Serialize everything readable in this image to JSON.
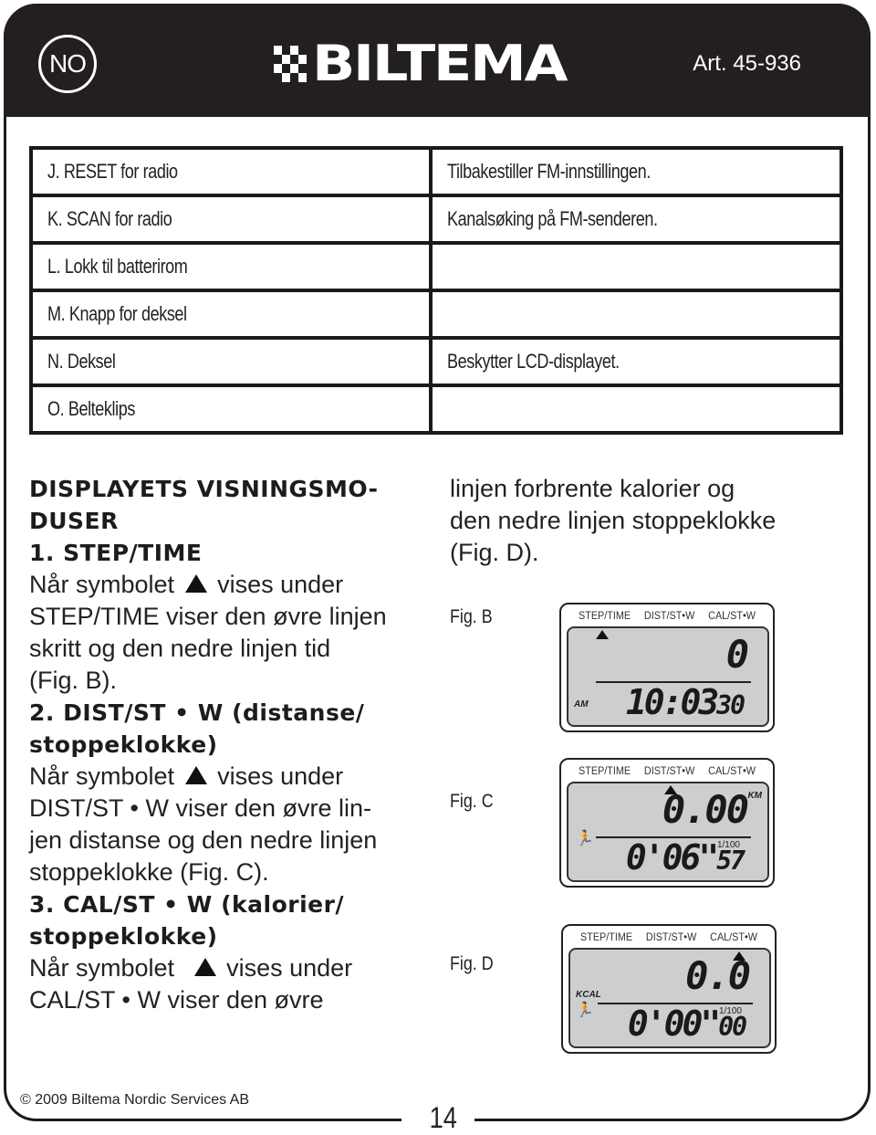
{
  "header": {
    "language_badge": "NO",
    "brand": "BILTEMA",
    "article_number": "Art. 45-936",
    "colors": {
      "header_bg": "#231f20",
      "header_fg": "#ffffff"
    }
  },
  "parts_table": {
    "rows": [
      {
        "part": "J. RESET for radio",
        "description": "Tilbakestiller FM-innstillingen."
      },
      {
        "part": "K. SCAN for radio",
        "description": "Kanalsøking på FM-senderen."
      },
      {
        "part": "L. Lokk til batterirom",
        "description": ""
      },
      {
        "part": "M. Knapp for deksel",
        "description": ""
      },
      {
        "part": "N. Deksel",
        "description": "Beskytter LCD-displayet."
      },
      {
        "part": "O. Belteklips",
        "description": ""
      }
    ]
  },
  "section": {
    "title_line1": "DISPLAYETS VISNINGSMO-",
    "title_line2": "DUSER",
    "modes": [
      {
        "heading": "1. STEP/TIME",
        "heading_line2": "",
        "text_before_symbol": "Når symbolet",
        "symbol_icon": "triangle-up",
        "text_lines": [
          "vises under",
          "STEP/TIME viser den øvre linjen",
          "skritt og den nedre linjen tid",
          "(Fig. B)."
        ]
      },
      {
        "heading": "2. DIST/ST • W (distanse/",
        "heading_line2": "stoppeklokke)",
        "text_before_symbol": "Når symbolet",
        "symbol_icon": "triangle-up",
        "text_lines": [
          "vises under",
          "DIST/ST • W viser den øvre lin-",
          "jen distanse og den nedre linjen",
          "stoppeklokke (Fig. C)."
        ]
      },
      {
        "heading": "3. CAL/ST • W (kalorier/",
        "heading_line2": "stoppeklokke)",
        "text_before_symbol": "Når symbolet",
        "symbol_icon": "triangle-up",
        "text_lines": [
          "vises under",
          "CAL/ST • W viser den øvre"
        ]
      }
    ],
    "continued_lines": [
      "linjen forbrente kalorier og",
      "den nedre linjen stoppeklokke",
      "(Fig. D)."
    ]
  },
  "figures": [
    {
      "label": "Fig. B",
      "mode_labels": [
        "STEP/TIME",
        "DIST/ST•W",
        "CAL/ST•W"
      ],
      "active_mode": "STEP/TIME",
      "upper_value": "0",
      "lower_main": "10:03",
      "lower_small": "30",
      "left_tag": "AM",
      "unit_tag": "",
      "hundredths_label": "",
      "runner_icon": false
    },
    {
      "label": "Fig. C",
      "mode_labels": [
        "STEP/TIME",
        "DIST/ST•W",
        "CAL/ST•W"
      ],
      "active_mode": "DIST/ST•W",
      "upper_value": "0.00",
      "lower_main": "0'06\"",
      "lower_small": "57",
      "left_tag": "",
      "unit_tag": "KM",
      "hundredths_label": "1/100",
      "runner_icon": true
    },
    {
      "label": "Fig. D",
      "mode_labels": [
        "STEP/TIME",
        "DIST/ST•W",
        "CAL/ST•W"
      ],
      "active_mode": "CAL/ST•W",
      "upper_value": "0.0",
      "lower_main": "0'00\"",
      "lower_small": "00",
      "left_tag": "KCAL",
      "unit_tag": "",
      "hundredths_label": "1/100",
      "runner_icon": true
    }
  ],
  "footer": {
    "copyright": "© 2009 Biltema Nordic Services AB",
    "page_number": "14"
  }
}
